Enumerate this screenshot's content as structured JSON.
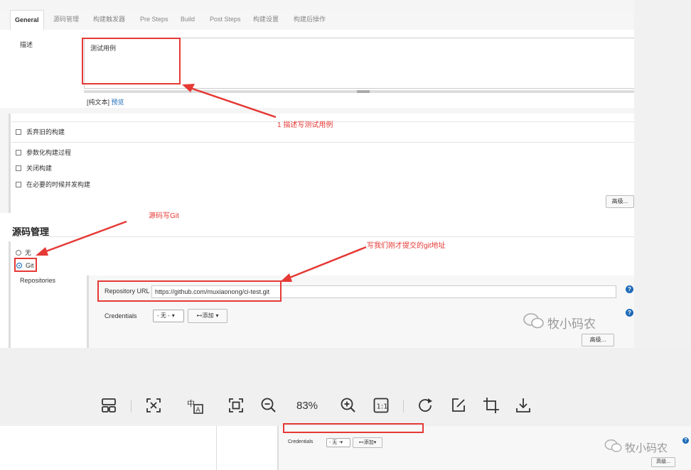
{
  "tabs": [
    "General",
    "源码管理",
    "构建触发器",
    "Pre Steps",
    "Build",
    "Post Steps",
    "构建设置",
    "构建后操作"
  ],
  "description": {
    "label": "描述",
    "value": "测试用例",
    "plain_text": "[纯文本]",
    "preview": "预览"
  },
  "options": {
    "discard": "丢弃旧的构建",
    "parameterized": "参数化构建过程",
    "disable": "关闭构建",
    "concurrent": "在必要的时候并发构建",
    "advanced": "高级..."
  },
  "scm": {
    "title": "源码管理",
    "none": "无",
    "git": "Git",
    "repositories_label": "Repositories",
    "repo_url_label": "Repository URL",
    "repo_url_value": "https://github.com/muxiaonong/ci-test.git",
    "credentials_label": "Credentials",
    "credentials_select": "- 无 -",
    "add_button": "添加",
    "advanced": "高级...",
    "help": "?"
  },
  "annotations": {
    "a1": "1 描述写测试用例",
    "a2": "源码写Git",
    "a3": "写我们刚才提交的git地址"
  },
  "watermark": "牧小码农",
  "toolbar": {
    "zoom": "83%",
    "icons": [
      "layout-icon",
      "fit-screen-icon",
      "translate-icon",
      "fullscreen-icon",
      "zoom-out-icon",
      "zoom-in-icon",
      "actual-size-icon",
      "rotate-icon",
      "edit-icon",
      "crop-icon",
      "download-icon"
    ]
  },
  "bottom": {
    "credentials_label": "Credentials",
    "credentials_select": "- 无 -",
    "add_button": "添加",
    "advanced": "高级...",
    "watermark": "牧小码农",
    "help": "?"
  },
  "colors": {
    "annotation": "#e53935",
    "link": "#1e6bb8",
    "toolbar_bg": "#f0f0f0"
  }
}
